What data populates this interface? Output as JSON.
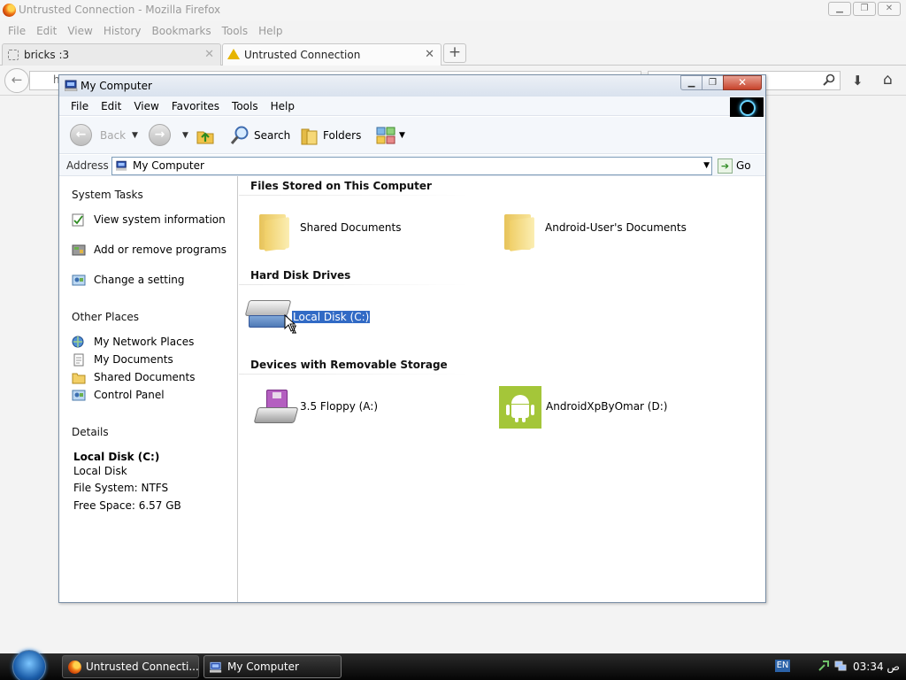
{
  "firefox": {
    "title": "Untrusted Connection - Mozilla Firefox",
    "menu": [
      "File",
      "Edit",
      "View",
      "History",
      "Bookmarks",
      "Tools",
      "Help"
    ],
    "tabs": [
      {
        "label": "bricks :3"
      },
      {
        "label": "Untrusted Connection"
      }
    ],
    "new_tab": "+",
    "url_partial": "h"
  },
  "explorer": {
    "title": "My Computer",
    "menu": [
      "File",
      "Edit",
      "View",
      "Favorites",
      "Tools",
      "Help"
    ],
    "toolbar": {
      "back": "Back",
      "search": "Search",
      "folders": "Folders"
    },
    "address": {
      "label": "Address",
      "value": "My Computer",
      "go": "Go"
    },
    "sidebar": {
      "system_tasks": {
        "title": "System Tasks",
        "items": [
          "View system information",
          "Add or remove programs",
          "Change a setting"
        ]
      },
      "other_places": {
        "title": "Other Places",
        "items": [
          "My Network Places",
          "My Documents",
          "Shared Documents",
          "Control Panel"
        ]
      },
      "details": {
        "title": "Details",
        "name": "Local Disk (C:)",
        "type": "Local Disk",
        "filesystem": "File System: NTFS",
        "free": "Free Space: 6.57 GB"
      }
    },
    "groups": [
      {
        "title": "Files Stored on This Computer",
        "items": [
          "Shared Documents",
          "Android-User's Documents"
        ]
      },
      {
        "title": "Hard Disk Drives",
        "items": [
          "Local Disk (C:)"
        ]
      },
      {
        "title": "Devices with Removable Storage",
        "items": [
          "3.5 Floppy (A:)",
          "AndroidXpByOmar (D:)"
        ]
      }
    ]
  },
  "taskbar": {
    "buttons": [
      "Untrusted Connecti...",
      "My Computer"
    ],
    "language": "EN",
    "clock": "03:34 ص"
  },
  "colors": {
    "selection": "#316ac5",
    "android_green": "#a4c639"
  }
}
